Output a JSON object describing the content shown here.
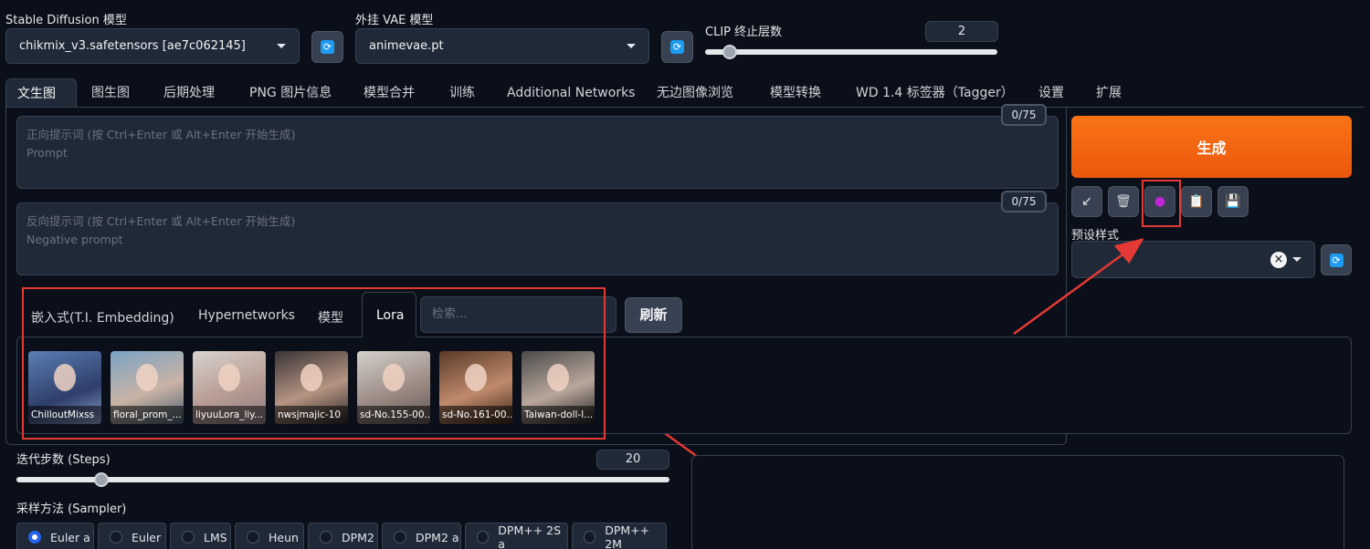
{
  "top": {
    "sd_model_label": "Stable Diffusion 模型",
    "sd_model_value": "chikmix_v3.safetensors [ae7c062145]",
    "vae_label": "外挂 VAE 模型",
    "vae_value": "animevae.pt",
    "clip_label": "CLIP 终止层数",
    "clip_value": "2",
    "clip_level": 0.083
  },
  "tabs": [
    "文生图",
    "图生图",
    "后期处理",
    "PNG 图片信息",
    "模型合并",
    "训练",
    "Additional Networks",
    "无边图像浏览",
    "模型转换",
    "WD 1.4 标签器（Tagger）",
    "设置",
    "扩展"
  ],
  "prompt": {
    "placeholder_line1": "正向提示词 (按 Ctrl+Enter 或 Alt+Enter 开始生成)",
    "placeholder_line2": "Prompt",
    "token_count": "0/75"
  },
  "negative": {
    "placeholder_line1": "反向提示词 (按 Ctrl+Enter 或 Alt+Enter 开始生成)",
    "placeholder_line2": "Negative prompt",
    "token_count": "0/75"
  },
  "generate_label": "生成",
  "tools": {
    "icons": [
      "arrow-icon",
      "trash-icon",
      "extra-networks-icon",
      "clipboard-icon",
      "save-icon"
    ],
    "glyphs": [
      "↙",
      "🗑",
      "●",
      "📋",
      "💾"
    ]
  },
  "styles": {
    "label": "预设样式",
    "clear_glyph": "×"
  },
  "extra_networks": {
    "tabs": [
      "嵌入式(T.I. Embedding)",
      "Hypernetworks",
      "模型",
      "Lora"
    ],
    "active_tab": "Lora",
    "search_placeholder": "检索...",
    "refresh_label": "刷新",
    "cards": [
      {
        "caption": "ChilloutMixss"
      },
      {
        "caption": "floral_prom_..."
      },
      {
        "caption": "liyuuLora_liy..."
      },
      {
        "caption": "nwsjmajic-10"
      },
      {
        "caption": "sd-No.155-00..."
      },
      {
        "caption": "sd-No.161-00..."
      },
      {
        "caption": "Taiwan-doll-l..."
      }
    ]
  },
  "steps": {
    "label": "迭代步数 (Steps)",
    "value": "20",
    "level": 0.13
  },
  "sampler": {
    "label": "采样方法 (Sampler)",
    "options": [
      "Euler a",
      "Euler",
      "LMS",
      "Heun",
      "DPM2",
      "DPM2 a",
      "DPM++ 2S a",
      "DPM++ 2M"
    ],
    "selected": "Euler a"
  },
  "colors": {
    "accent": "#ea580c",
    "highlight": "#e53935",
    "refresh_icon": "#1d9bf0"
  }
}
